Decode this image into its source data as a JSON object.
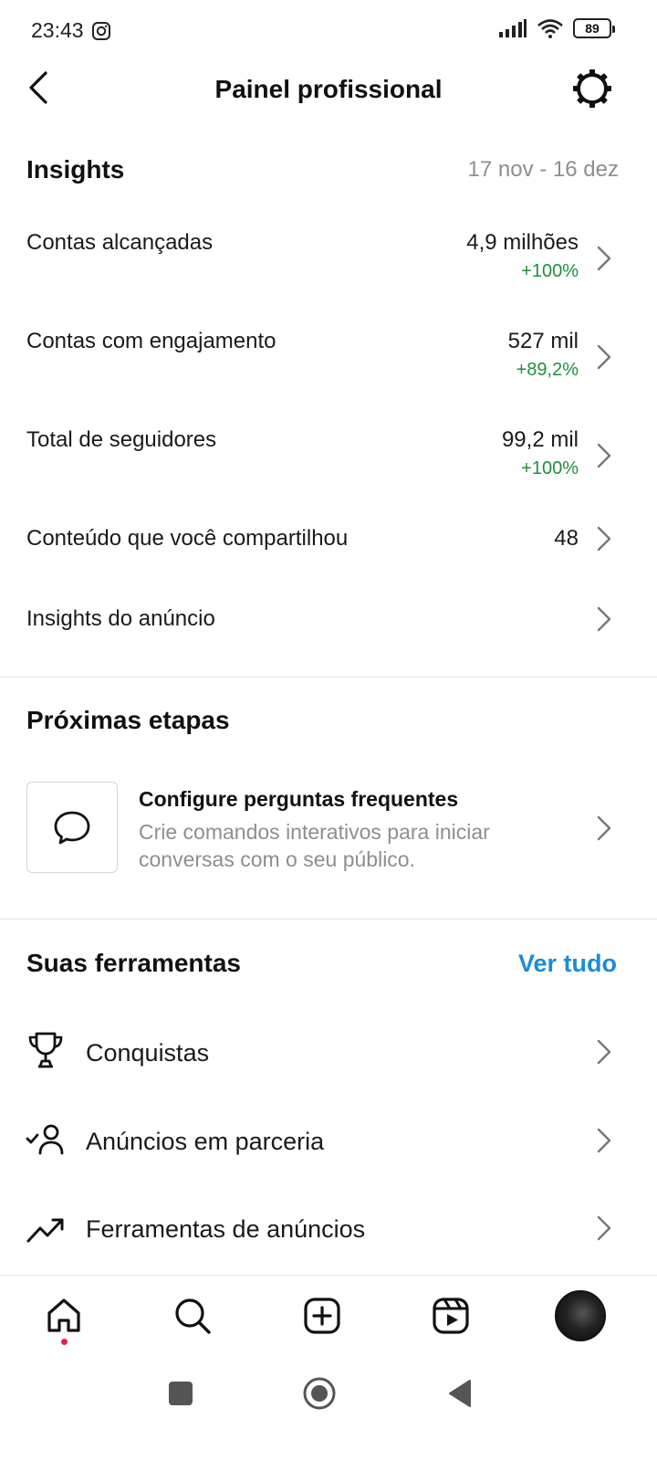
{
  "status_bar": {
    "time": "23:43",
    "battery": "89",
    "icons": [
      "instagram-icon",
      "signal-icon",
      "wifi-icon",
      "battery-icon"
    ]
  },
  "header": {
    "title": "Painel profissional",
    "back_icon": "chevron-left-icon",
    "settings_icon": "gear-icon"
  },
  "insights": {
    "title": "Insights",
    "date_range": "17 nov - 16 dez",
    "rows": [
      {
        "label": "Contas alcançadas",
        "value": "4,9 milhões",
        "delta": "+100%"
      },
      {
        "label": "Contas com engajamento",
        "value": "527 mil",
        "delta": "+89,2%"
      },
      {
        "label": "Total de seguidores",
        "value": "99,2 mil",
        "delta": "+100%"
      },
      {
        "label": "Conteúdo que você compartilhou",
        "value": "48",
        "delta": ""
      },
      {
        "label": "Insights do anúncio",
        "value": "",
        "delta": ""
      }
    ]
  },
  "next_steps": {
    "title": "Próximas etapas",
    "card": {
      "icon": "chat-bubble-icon",
      "title": "Configure perguntas frequentes",
      "description": "Crie comandos interativos para iniciar conversas com o seu público."
    }
  },
  "tools": {
    "title": "Suas ferramentas",
    "see_all": "Ver tudo",
    "items": [
      {
        "label": "Conquistas",
        "icon": "trophy-icon"
      },
      {
        "label": "Anúncios em parceria",
        "icon": "partner-user-check-icon"
      },
      {
        "label": "Ferramentas de anúncios",
        "icon": "trending-up-icon"
      }
    ]
  },
  "bottom_nav": {
    "items": [
      "home-icon",
      "search-icon",
      "create-icon",
      "reels-icon",
      "profile-avatar"
    ],
    "active": "home-icon"
  },
  "system_nav": {
    "items": [
      "recents-button",
      "home-button",
      "back-button"
    ]
  },
  "colors": {
    "positive": "#1f8f3a",
    "link": "#1a8cd8",
    "muted": "#8e8e8e",
    "notification_dot": "#ed1c4a"
  }
}
